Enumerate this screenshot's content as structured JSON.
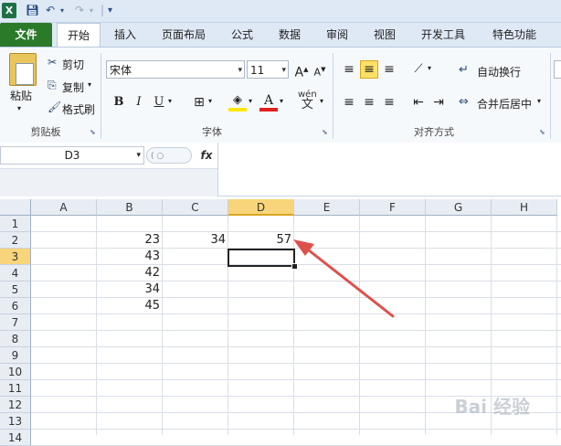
{
  "qat": {
    "logo": "X",
    "icons": [
      "save-icon",
      "undo-icon",
      "redo-icon",
      "customize-icon"
    ]
  },
  "tabs": [
    "文件",
    "开始",
    "插入",
    "页面布局",
    "公式",
    "数据",
    "审阅",
    "视图",
    "开发工具",
    "特色功能"
  ],
  "ribbon": {
    "clipboard": {
      "paste": "粘贴",
      "cut": "剪切",
      "copy": "复制",
      "format_painter": "格式刷",
      "group": "剪贴板"
    },
    "font": {
      "name": "宋体",
      "size": "11",
      "bold": "B",
      "italic": "I",
      "underline": "U",
      "wen": "wén",
      "wen_sub": "文",
      "group": "字体"
    },
    "alignment": {
      "wrap": "自动换行",
      "merge": "合并后居中",
      "group": "对齐方式"
    }
  },
  "formula_bar": {
    "name_box": "D3",
    "fx": "fx",
    "content": ""
  },
  "sheet": {
    "columns": [
      "A",
      "B",
      "C",
      "D",
      "E",
      "F",
      "G",
      "H"
    ],
    "rows": [
      "1",
      "2",
      "3",
      "4",
      "5",
      "6",
      "7",
      "8",
      "9",
      "10",
      "11",
      "12",
      "13",
      "14"
    ],
    "selected_column": "D",
    "selected_row": "3",
    "cells": [
      {
        "ref": "B2",
        "value": "23"
      },
      {
        "ref": "C2",
        "value": "34"
      },
      {
        "ref": "D2",
        "value": "57"
      },
      {
        "ref": "B3",
        "value": "43"
      },
      {
        "ref": "B4",
        "value": "42"
      },
      {
        "ref": "B5",
        "value": "34"
      },
      {
        "ref": "B6",
        "value": "45"
      }
    ]
  },
  "annotation": {
    "arrow_color": "#e0504a"
  },
  "colors": {
    "file_tab": "#2a7a2a",
    "selected_header": "#f8d57a",
    "highlight": "#ffe066"
  },
  "watermark": "Bai 经验"
}
